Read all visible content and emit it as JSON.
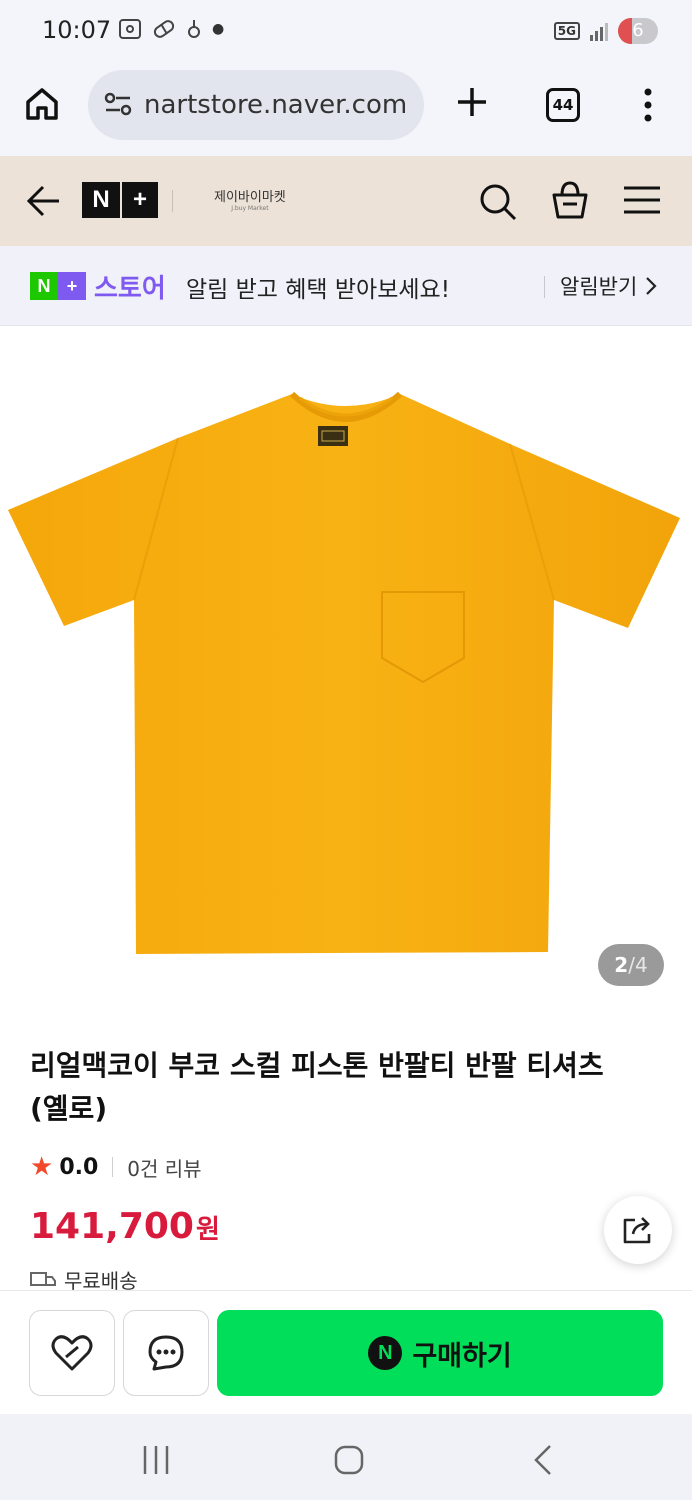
{
  "status_bar": {
    "time": "10:07",
    "network": "5G",
    "battery_level": "6"
  },
  "browser": {
    "url": "nartstore.naver.com",
    "tab_count": "44"
  },
  "store_header": {
    "logo_left": "N",
    "logo_right": "+",
    "brand_name": "제이바이마켓",
    "brand_sub": "J.buy Market"
  },
  "promo": {
    "badge_left": "N",
    "badge_right": "+",
    "store_label": "스토어",
    "message": "알림 받고 혜택 받아보세요!",
    "cta": "알림받기"
  },
  "product": {
    "image_index": "2",
    "image_sep": "/",
    "image_total": "4",
    "title": "리얼맥코이 부코 스컬 피스톤 반팔티 반팔 티셔츠 (옐로)",
    "rating_score": "0.0",
    "review_count": "0건 리뷰",
    "price": "141,700",
    "price_unit": "원",
    "shipping": "무료배송",
    "shirt_color": "#f7ae0c"
  },
  "actions": {
    "buy_icon": "N",
    "buy_label": "구매하기"
  },
  "colors": {
    "naver_green": "#00de5a",
    "price_red": "#d81b3c",
    "plus_purple": "#7f5af0"
  }
}
